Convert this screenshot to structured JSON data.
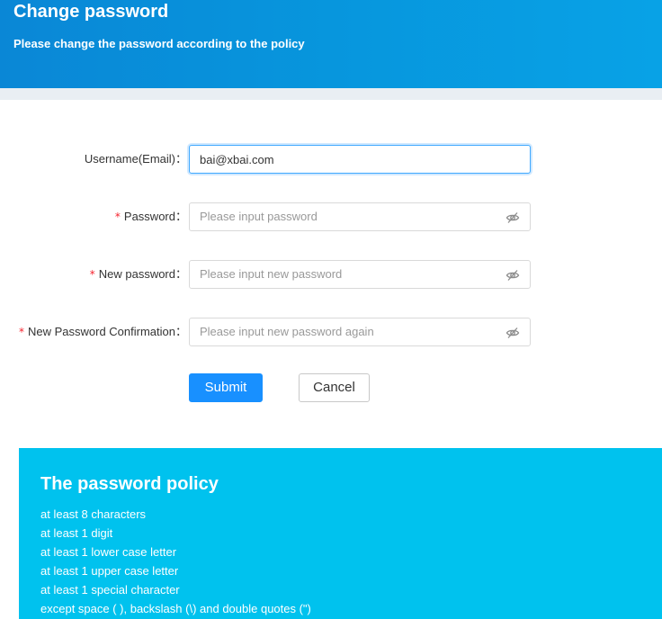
{
  "header": {
    "title": "Change password",
    "subtitle": "Please change the password according to the policy"
  },
  "form": {
    "username": {
      "label": "Username(Email)：",
      "value": "bai@xbai.com"
    },
    "password": {
      "required_mark": "*",
      "label": "Password：",
      "placeholder": "Please input password",
      "icon": "eye-slash-icon"
    },
    "new_password": {
      "required_mark": "*",
      "label": "New password：",
      "placeholder": "Please input new password",
      "icon": "eye-slash-icon"
    },
    "confirm_password": {
      "required_mark": "*",
      "label": "New Password Confirmation：",
      "placeholder": "Please input new password again",
      "icon": "eye-slash-icon"
    },
    "submit_label": "Submit",
    "cancel_label": "Cancel"
  },
  "policy": {
    "title": "The password policy",
    "rules": [
      "at least 8 characters",
      "at least 1 digit",
      "at least 1 lower case letter",
      "at least 1 upper case letter",
      "at least 1 special character",
      "except space ( ), backslash (\\) and double quotes (\")"
    ]
  },
  "colors": {
    "header": "#0a87d6",
    "primary_button": "#1890ff",
    "policy_background": "#00c2ee",
    "required_mark": "#f5222d"
  }
}
